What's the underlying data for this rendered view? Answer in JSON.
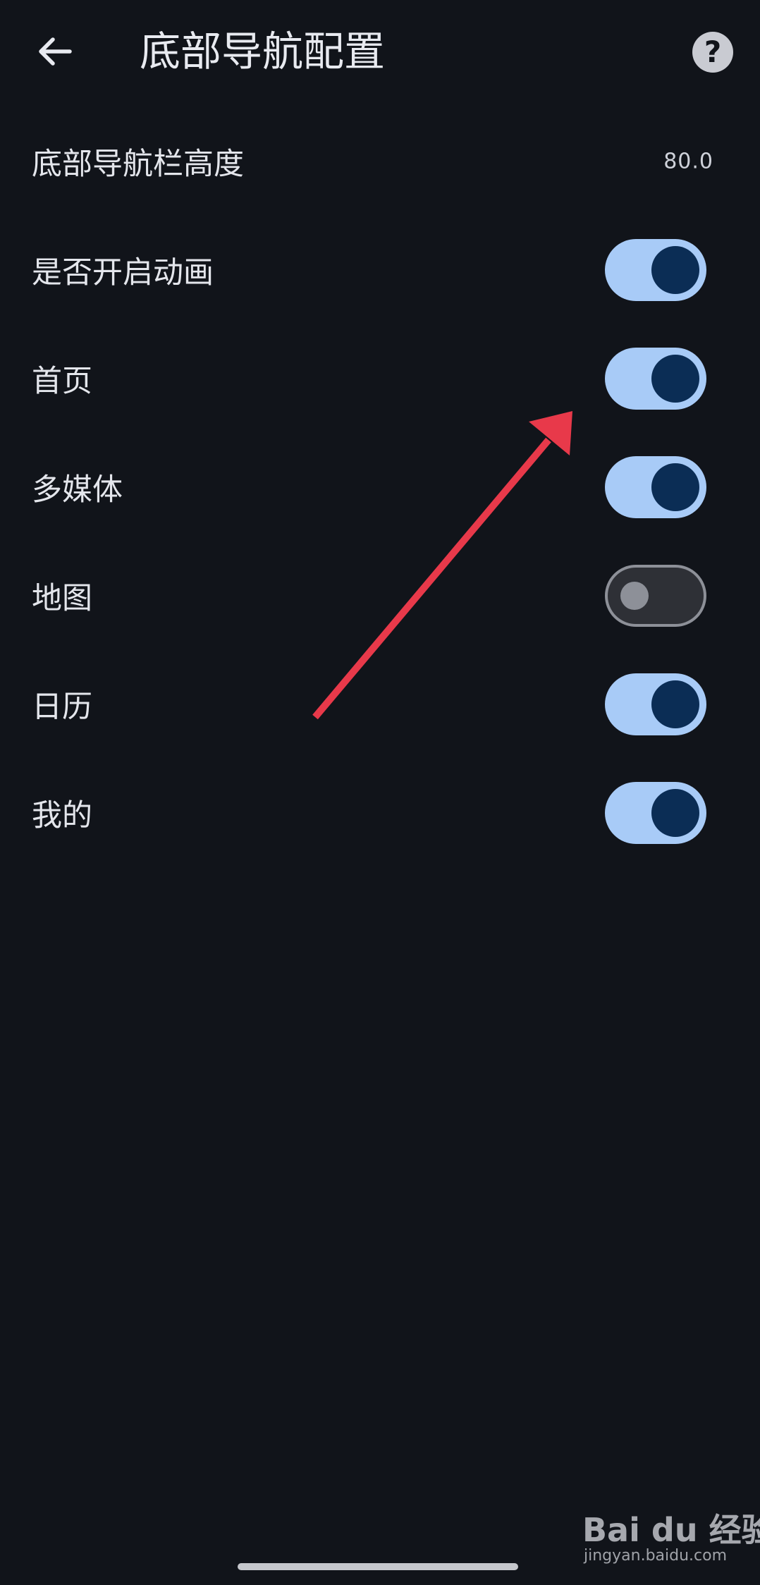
{
  "header": {
    "title": "底部导航配置",
    "back_icon": "arrow-left-icon",
    "help_icon": "question-mark-icon",
    "help_glyph": "?"
  },
  "settings": [
    {
      "label": "底部导航栏高度",
      "type": "value",
      "value": "80.0"
    },
    {
      "label": "是否开启动画",
      "type": "switch",
      "checked": true
    },
    {
      "label": "首页",
      "type": "switch",
      "checked": true
    },
    {
      "label": "多媒体",
      "type": "switch",
      "checked": true
    },
    {
      "label": "地图",
      "type": "switch",
      "checked": false
    },
    {
      "label": "日历",
      "type": "switch",
      "checked": true
    },
    {
      "label": "我的",
      "type": "switch",
      "checked": true
    }
  ],
  "watermark": {
    "logo": "Bai du 经验",
    "url": "jingyan.baidu.com"
  },
  "colors": {
    "background": "#11141a",
    "switch_on_track": "#a8cbf7",
    "switch_on_thumb": "#0b2d55",
    "switch_off_track": "#2e3036",
    "switch_off_outline": "#8d9098",
    "annotation_arrow": "#e8394a"
  }
}
